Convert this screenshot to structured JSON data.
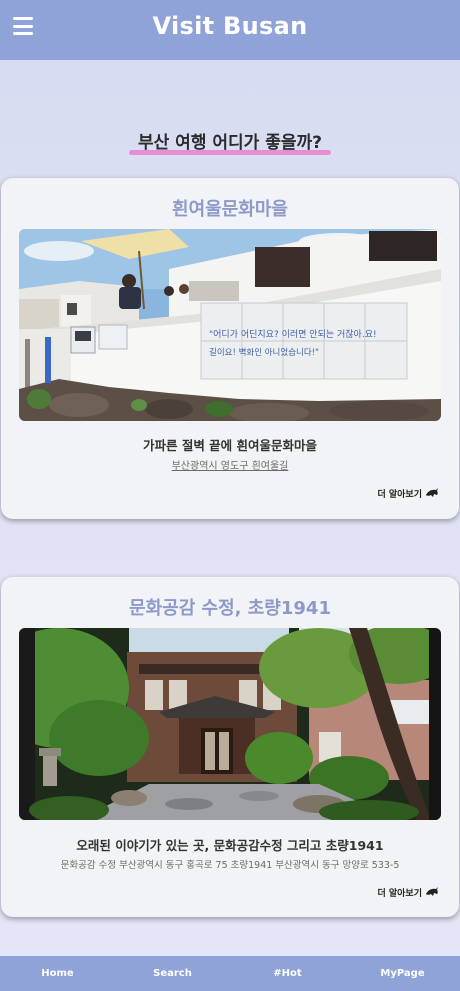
{
  "header": {
    "title": "Visit Busan",
    "menu_icon": "hamburger-menu-icon"
  },
  "section": {
    "heading": "부산 여행 어디가 좋을까?"
  },
  "cards": [
    {
      "title": "흰여울문화마을",
      "image_alt": "흰여울문화마을 벽화와 파라솔",
      "mural_text_1": "\"어디가 어딘지요? 이러면 안되는 거잖아.요!",
      "mural_text_2": "길이요!   벽화인 아니었습니다!\"",
      "caption": "가파른 절벽 끝에 흰여울문화마을",
      "address": "부산광역시 영도구 흰여울길",
      "more_label": "더 알아보기",
      "more_icon": "dolphin-icon"
    },
    {
      "title": "문화공감 수정, 초량1941",
      "image_alt": "문화공감 수정 일본식 목조 가옥과 정원",
      "caption": "오래된 이야기가 있는 곳, 문화공감수정 그리고 초량1941",
      "address": "문화공감 수정 부산광역시 동구 홍곡로 75 초량1941 부산광역시 동구 망양로 533-5",
      "more_label": "더 알아보기",
      "more_icon": "dolphin-icon"
    }
  ],
  "nav": {
    "items": [
      "Home",
      "Search",
      "#Hot",
      "MyPage"
    ]
  },
  "colors": {
    "header_bg": "#8fa3d8",
    "card_title": "#8b9ac9",
    "heading_underline": "#e58fd1",
    "page_bg": "#dde1f4"
  }
}
